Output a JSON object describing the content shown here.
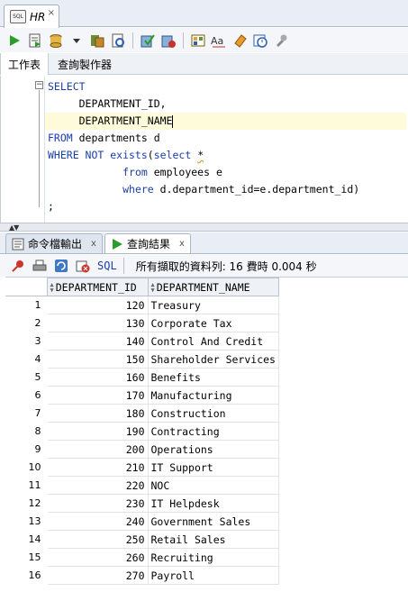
{
  "window": {
    "doc_tab_label": "HR",
    "doc_tab_icon": "sql-worksheet-icon",
    "doc_tab_close": "×"
  },
  "subtabs": [
    "工作表",
    "查詢製作器"
  ],
  "editor": {
    "lines": [
      {
        "kw": "SELECT",
        "rest": ""
      },
      {
        "indent": "     ",
        "text": "DEPARTMENT_ID,"
      },
      {
        "indent": "     ",
        "text": "DEPARTMENT_NAME"
      },
      {
        "kw": "FROM",
        "rest": " departments d"
      },
      {
        "kw": "WHERE NOT exists",
        "rest": "(",
        "kw2": "select",
        "star": "*"
      },
      {
        "indent": "            ",
        "kw": "from",
        "rest": " employees e"
      },
      {
        "indent": "            ",
        "kw": "where",
        "rest": " d.department_id=e.department_id)"
      },
      {
        "text": ";"
      }
    ]
  },
  "results_tabs": {
    "script_output": "命令檔輸出",
    "query_result": "查詢結果",
    "close": "x"
  },
  "results_toolbar": {
    "sql_label": "SQL",
    "status": "所有擷取的資料列: 16 費時 0.004 秒"
  },
  "grid": {
    "columns": [
      "DEPARTMENT_ID",
      "DEPARTMENT_NAME"
    ],
    "rows": [
      [
        1,
        120,
        "Treasury"
      ],
      [
        2,
        130,
        "Corporate Tax"
      ],
      [
        3,
        140,
        "Control And Credit"
      ],
      [
        4,
        150,
        "Shareholder Services"
      ],
      [
        5,
        160,
        "Benefits"
      ],
      [
        6,
        170,
        "Manufacturing"
      ],
      [
        7,
        180,
        "Construction"
      ],
      [
        8,
        190,
        "Contracting"
      ],
      [
        9,
        200,
        "Operations"
      ],
      [
        10,
        210,
        "IT Support"
      ],
      [
        11,
        220,
        "NOC"
      ],
      [
        12,
        230,
        "IT Helpdesk"
      ],
      [
        13,
        240,
        "Government Sales"
      ],
      [
        14,
        250,
        "Retail Sales"
      ],
      [
        15,
        260,
        "Recruiting"
      ],
      [
        16,
        270,
        "Payroll"
      ]
    ]
  },
  "colors": {
    "keyword": "#1b3fa8",
    "highlight_line": "#fdfbd9",
    "run_green": "#2a9d2a"
  }
}
